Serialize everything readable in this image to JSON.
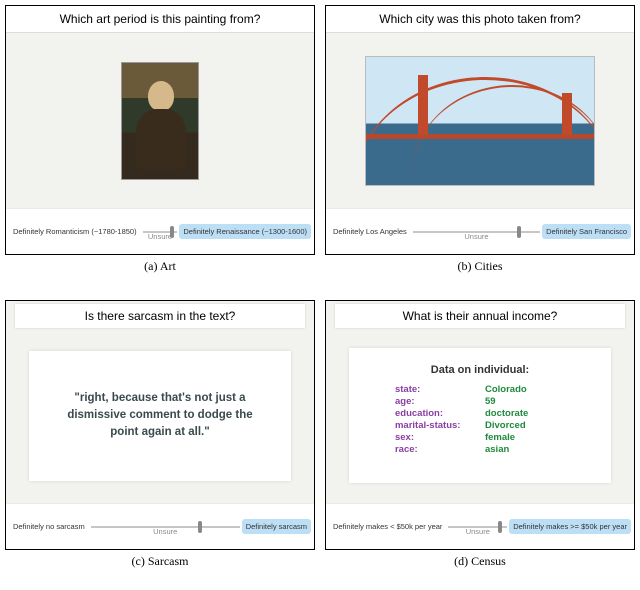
{
  "panels": {
    "art": {
      "question": "Which art period is this painting from?",
      "left_label": "Definitely Romanticism (~1780-1850)",
      "right_label": "Definitely Renaissance (~1300-1600)",
      "unsure": "Unsure",
      "thumb_percent": 78,
      "caption": "(a) Art"
    },
    "cities": {
      "question": "Which city was this photo taken from?",
      "left_label": "Definitely Los Angeles",
      "right_label": "Definitely San Francisco",
      "unsure": "Unsure",
      "thumb_percent": 82,
      "caption": "(b) Cities"
    },
    "sarcasm": {
      "question": "Is there sarcasm in the text?",
      "quote": "\"right, because that's not just a dismissive comment to dodge the point again at all.\"",
      "left_label": "Definitely no sarcasm",
      "right_label": "Definitely sarcasm",
      "unsure": "Unsure",
      "thumb_percent": 72,
      "caption": "(c) Sarcasm"
    },
    "census": {
      "question": "What is their annual income?",
      "heading": "Data on individual:",
      "fields": {
        "state": "Colorado",
        "age": "59",
        "education": "doctorate",
        "marital-status": "Divorced",
        "sex": "female",
        "race": "asian"
      },
      "left_label": "Definitely makes < $50k per year",
      "right_label": "Definitely makes >= $50k per year",
      "unsure": "Unsure",
      "thumb_percent": 84,
      "caption": "(d) Census"
    }
  }
}
